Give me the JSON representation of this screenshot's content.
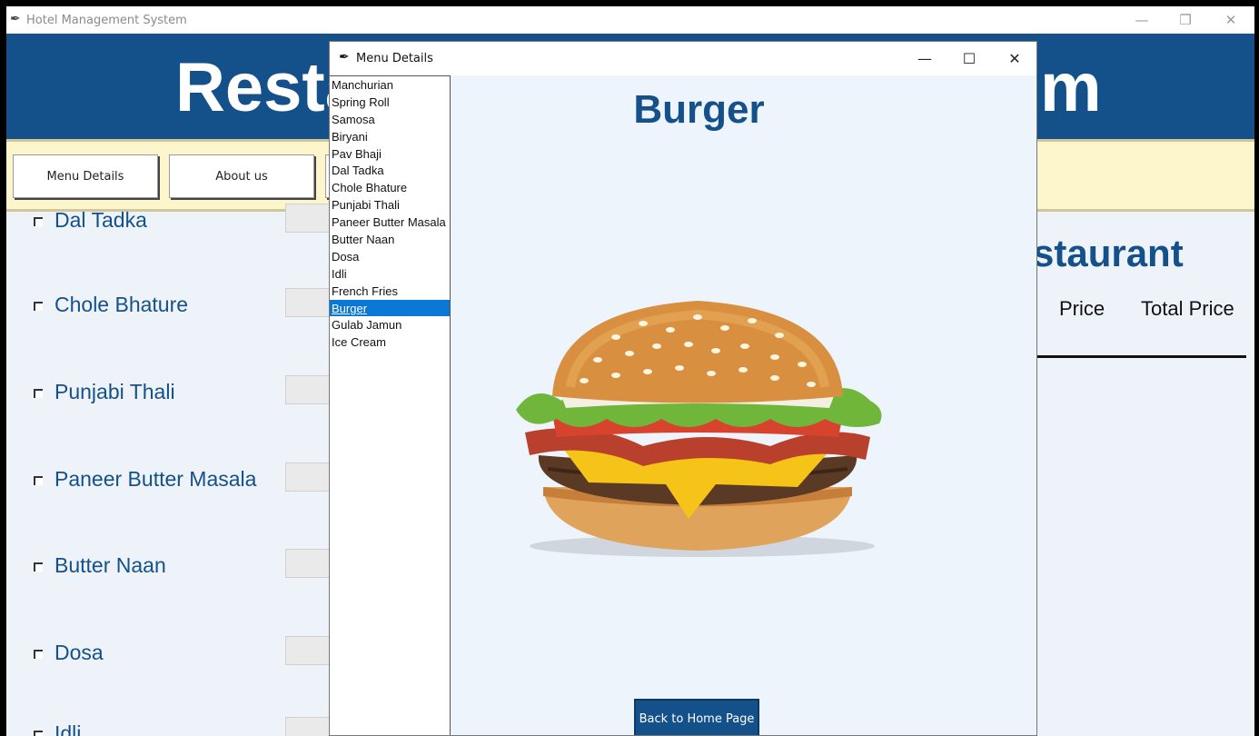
{
  "main_window": {
    "title": "Hotel Management System",
    "controls": {
      "minimize": "—",
      "restore": "❐",
      "close": "✕"
    }
  },
  "banner": {
    "visible_left": "Resta",
    "visible_right": "m"
  },
  "buttons": {
    "menu_details": "Menu Details",
    "about_us": "About us"
  },
  "menu_items": [
    {
      "label": "Dal Tadka"
    },
    {
      "label": "Chole Bhature"
    },
    {
      "label": "Punjabi Thali"
    },
    {
      "label": "Paneer Butter Masala"
    },
    {
      "label": "Butter Naan"
    },
    {
      "label": "Dosa"
    },
    {
      "label": "Idli"
    }
  ],
  "bill_panel": {
    "heading_visible": "staurant",
    "columns": [
      "Price",
      "Total Price"
    ]
  },
  "dialog": {
    "title": "Menu Details",
    "controls": {
      "minimize": "—",
      "maximize": "☐",
      "close": "✕"
    },
    "list": [
      "Manchurian",
      "Spring Roll",
      "Samosa",
      "Biryani",
      "Pav Bhaji",
      "Dal Tadka",
      "Chole Bhature",
      "Punjabi Thali",
      "Paneer Butter Masala",
      "Butter Naan",
      "Dosa",
      "Idli",
      "French Fries",
      "Burger",
      "Gulab Jamun",
      "Ice Cream"
    ],
    "selected_item": "Burger",
    "item_title": "Burger",
    "back_button": "Back to Home Page"
  },
  "colors": {
    "brand_blue": "#14508a",
    "button_bar": "#fdf6cc",
    "selection": "#0a78d7"
  }
}
